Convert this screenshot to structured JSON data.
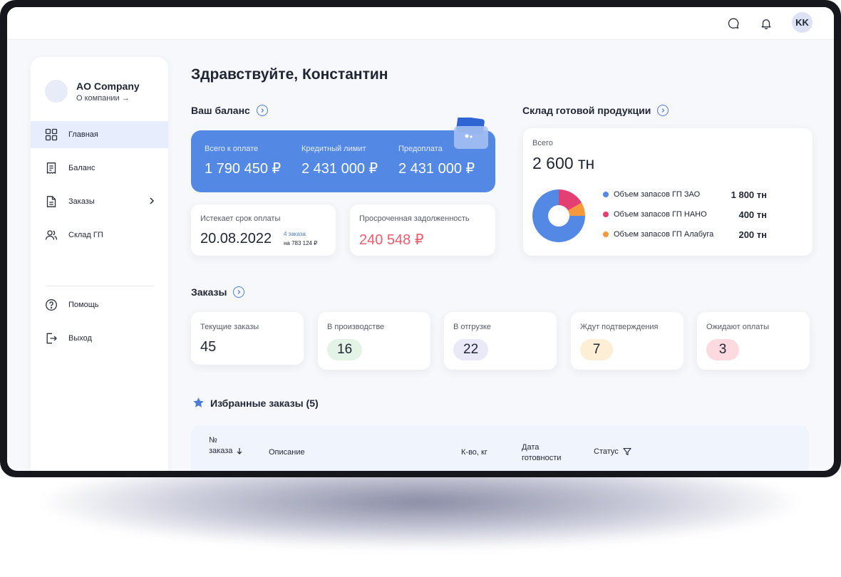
{
  "topbar": {
    "avatar_initials": "KK",
    "icons": [
      "chat-icon",
      "bell-icon"
    ]
  },
  "sidebar": {
    "company_name": "AO Company",
    "company_link": "О компании →",
    "items": [
      {
        "label": "Главная",
        "icon": "grid-icon",
        "active": true
      },
      {
        "label": "Баланс",
        "icon": "receipt-icon"
      },
      {
        "label": "Заказы",
        "icon": "document-icon",
        "has_submenu": true
      },
      {
        "label": "Склад ГП",
        "icon": "users-icon"
      },
      {
        "label": "Помощь",
        "icon": "help-icon"
      },
      {
        "label": "Выход",
        "icon": "logout-icon"
      }
    ]
  },
  "greeting": "Здравствуйте, Константин",
  "balance": {
    "title": "Ваш баланс",
    "total_label": "Всего к оплате",
    "total_value": "1 790 450 ₽",
    "credit_label": "Кредитный лимит",
    "credit_value": "2 431 000 ₽",
    "prepay_label": "Предоплата",
    "prepay_value": "2 431 000 ₽",
    "due_label": "Истекает срок оплаты",
    "due_date": "20.08.2022",
    "due_orders_link": "4 заказа",
    "due_orders_sum": "на 783 124 ₽",
    "overdue_label": "Просроченная задолженность",
    "overdue_value": "240 548 ₽",
    "accent_color": "#5388e4",
    "overdue_color": "#ec5d6e"
  },
  "warehouse": {
    "title": "Склад готовой продукции",
    "total_label": "Всего",
    "total_value": "2 600 тн",
    "legend": [
      {
        "label": "Объем запасов ГП ЗАО",
        "amount": "1 800 тн",
        "color": "#5388e4",
        "value": 1800
      },
      {
        "label": "Объем запасов ГП НАНО",
        "amount": "400 тн",
        "color": "#e43f72",
        "value": 400
      },
      {
        "label": "Объем запасов ГП Алабуга",
        "amount": "200 тн",
        "color": "#f6993a",
        "value": 200
      }
    ]
  },
  "orders": {
    "title": "Заказы",
    "cards": [
      {
        "label": "Текущие заказы",
        "value": "45",
        "pill_color": ""
      },
      {
        "label": "В производстве",
        "value": "16",
        "pill_color": "#e3f4e6"
      },
      {
        "label": "В отгрузке",
        "value": "22",
        "pill_color": "#e9e9f8"
      },
      {
        "label": "Ждут подтверждения",
        "value": "7",
        "pill_color": "#fcefd6"
      },
      {
        "label": "Ожидают оплаты",
        "value": "3",
        "pill_color": "#fcdadf"
      }
    ]
  },
  "favorites": {
    "title": "Избранные заказы (5)",
    "columns": {
      "number_line1": "№",
      "number_line2": "заказа",
      "description": "Описание",
      "quantity": "К-во, кг",
      "date_line1": "Дата",
      "date_line2": "готовности",
      "status": "Статус"
    }
  }
}
